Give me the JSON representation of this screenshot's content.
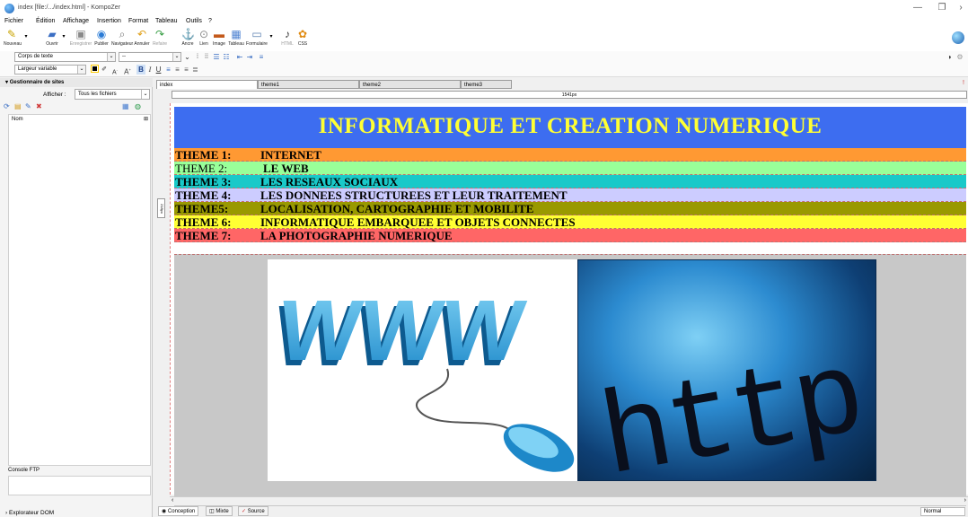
{
  "window": {
    "title": "index [file:/.../index.html] - KompoZer",
    "minimize": "—",
    "maximize": "❐",
    "close": "›"
  },
  "menu": [
    "Fichier",
    "Édition",
    "Affichage",
    "Insertion",
    "Format",
    "Tableau",
    "Outils",
    "?"
  ],
  "toolbar": {
    "buttons": [
      {
        "icon": "new-doc-icon",
        "glyph": "✎",
        "label": "Nouveau"
      },
      {
        "icon": "open-icon",
        "glyph": "▰",
        "label": "Ouvrir"
      },
      {
        "icon": "save-icon",
        "glyph": "▣",
        "label": "Enregistrer",
        "disabled": true
      },
      {
        "icon": "publish-icon",
        "glyph": "◉",
        "label": "Publier"
      },
      {
        "icon": "browser-icon",
        "glyph": "⌕",
        "label": "Navigateur"
      },
      {
        "icon": "undo-icon",
        "glyph": "↶",
        "label": "Annuler"
      },
      {
        "icon": "redo-icon",
        "glyph": "↷",
        "label": "Refaire",
        "disabled": true
      },
      {
        "icon": "anchor-icon",
        "glyph": "⚓",
        "label": "Ancre"
      },
      {
        "icon": "link-icon",
        "glyph": "⊙",
        "label": "Lien"
      },
      {
        "icon": "image-icon",
        "glyph": "▬",
        "label": "Image"
      },
      {
        "icon": "table-icon",
        "glyph": "▦",
        "label": "Tableau"
      },
      {
        "icon": "form-icon",
        "glyph": "▭",
        "label": "Formulaire"
      },
      {
        "icon": "html-icon",
        "glyph": "♪",
        "label": "HTML",
        "disabled": true
      },
      {
        "icon": "css-icon",
        "glyph": "✿",
        "label": "CSS"
      }
    ]
  },
  "format1": {
    "paragraph_select": "Corps de texte",
    "font_select": "--"
  },
  "format2": {
    "width_select": "Largeur variable",
    "bold": "B",
    "italic": "I",
    "underline": "U"
  },
  "site_manager": {
    "header": "Gestionnaire de sites",
    "show_label": "Afficher :",
    "show_value": "Tous les fichiers",
    "tree_header": "Nom",
    "ftp_label": "Console FTP",
    "dom_label": "Explorateur DOM"
  },
  "editor": {
    "tabs": [
      "index",
      "theme1",
      "theme2",
      "theme3"
    ],
    "ruler_label": "1541px",
    "vruler_label": "218px",
    "banner": "INFORMATIQUE ET CREATION NUMERIQUE",
    "themes": [
      {
        "label": "THEME 1:",
        "title": "INTERNET",
        "color": "#ff9933",
        "label_bold": true
      },
      {
        "label": "THEME 2:",
        "title": "LE WEB",
        "color": "#99ff99",
        "label_bold": false
      },
      {
        "label": "THEME 3:",
        "title": "LES RESEAUX SOCIAUX",
        "color": "#19c9c9",
        "label_bold": true
      },
      {
        "label": "THEME 4:",
        "title": "LES DONNEES STRUCTUREES ET LEUR TRAITEMENT",
        "color": "#ccccff",
        "label_bold": true
      },
      {
        "label": "THEME5:",
        "title": "LOCALISATION, CARTOGRAPHIE ET MOBILITE",
        "color": "#999900",
        "label_bold": true
      },
      {
        "label": "THEME 6:",
        "title": "INFORMATIQUE EMBARQUEE ET OBJETS CONNECTES",
        "color": "#ffff33",
        "label_bold": true
      },
      {
        "label": "THEME 7:",
        "title": "LA PHOTOGRAPHIE NUMERIQUE",
        "color": "#ff6666",
        "label_bold": true
      }
    ],
    "image_www_text": "WWW",
    "image_http_text": "http://w"
  },
  "modes": [
    "Conception",
    "Mixte",
    "Source"
  ],
  "status": "Normal"
}
